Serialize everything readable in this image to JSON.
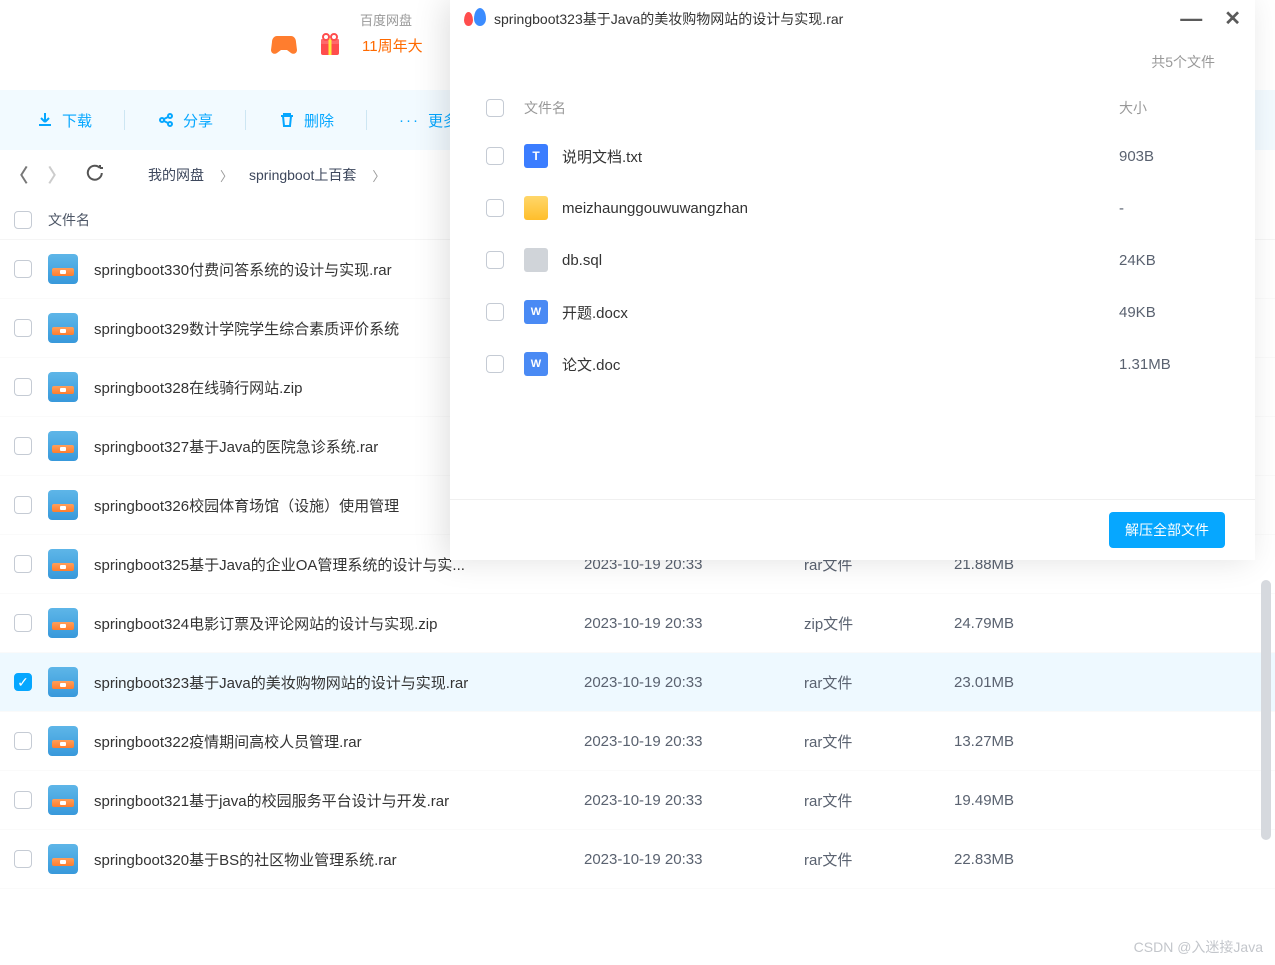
{
  "topbar": {
    "baidu_label": "百度网盘",
    "promo_text": "11周年大"
  },
  "toolbar": {
    "download": "下载",
    "share": "分享",
    "delete": "删除",
    "more": "更多"
  },
  "breadcrumb": {
    "root": "我的网盘",
    "path1": "springboot上百套"
  },
  "main_header": {
    "filename": "文件名"
  },
  "files": [
    {
      "name": "springboot330付费问答系统的设计与实现.rar",
      "date": "",
      "type": "",
      "size": "",
      "checked": false
    },
    {
      "name": "springboot329数计学院学生综合素质评价系统",
      "date": "",
      "type": "",
      "size": "",
      "checked": false
    },
    {
      "name": "springboot328在线骑行网站.zip",
      "date": "",
      "type": "",
      "size": "",
      "checked": false
    },
    {
      "name": "springboot327基于Java的医院急诊系统.rar",
      "date": "",
      "type": "",
      "size": "",
      "checked": false
    },
    {
      "name": "springboot326校园体育场馆（设施）使用管理",
      "date": "",
      "type": "",
      "size": "",
      "checked": false
    },
    {
      "name": "springboot325基于Java的企业OA管理系统的设计与实...",
      "date": "2023-10-19 20:33",
      "type": "rar文件",
      "size": "21.88MB",
      "checked": false
    },
    {
      "name": "springboot324电影订票及评论网站的设计与实现.zip",
      "date": "2023-10-19 20:33",
      "type": "zip文件",
      "size": "24.79MB",
      "checked": false
    },
    {
      "name": "springboot323基于Java的美妆购物网站的设计与实现.rar",
      "date": "2023-10-19 20:33",
      "type": "rar文件",
      "size": "23.01MB",
      "checked": true
    },
    {
      "name": "springboot322疫情期间高校人员管理.rar",
      "date": "2023-10-19 20:33",
      "type": "rar文件",
      "size": "13.27MB",
      "checked": false
    },
    {
      "name": "springboot321基于java的校园服务平台设计与开发.rar",
      "date": "2023-10-19 20:33",
      "type": "rar文件",
      "size": "19.49MB",
      "checked": false
    },
    {
      "name": "springboot320基于BS的社区物业管理系统.rar",
      "date": "2023-10-19 20:33",
      "type": "rar文件",
      "size": "22.83MB",
      "checked": false
    }
  ],
  "popup": {
    "title": "springboot323基于Java的美妆购物网站的设计与实现.rar",
    "count_label": "共5个文件",
    "col_name": "文件名",
    "col_size": "大小",
    "items": [
      {
        "name": "说明文档.txt",
        "size": "903B",
        "icon": "txt"
      },
      {
        "name": "meizhaunggouwuwangzhan",
        "size": "-",
        "icon": "folder"
      },
      {
        "name": "db.sql",
        "size": "24KB",
        "icon": "sql"
      },
      {
        "name": "开题.docx",
        "size": "49KB",
        "icon": "doc"
      },
      {
        "name": "论文.doc",
        "size": "1.31MB",
        "icon": "doc"
      }
    ],
    "extract_btn": "解压全部文件"
  },
  "watermark": "CSDN @入迷接Java"
}
